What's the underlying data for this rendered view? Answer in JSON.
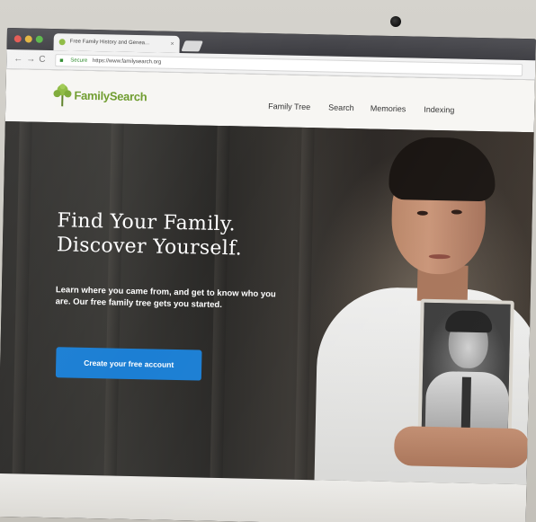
{
  "browser": {
    "tab_title": "Free Family History and Genea...",
    "tab_close": "×",
    "nav_back": "←",
    "nav_forward": "→",
    "nav_reload": "C",
    "secure_label": "Secure",
    "url": "https://www.familysearch.org"
  },
  "site": {
    "logo_text": "FamilySearch",
    "nav": [
      "Family Tree",
      "Search",
      "Memories",
      "Indexing"
    ]
  },
  "hero": {
    "title_line1": "Find Your Family.",
    "title_line2": "Discover Yourself.",
    "subtitle": "Learn where you came from, and get to know who you are. Our free family tree gets you started.",
    "cta_label": "Create your free account"
  },
  "colors": {
    "brand_green": "#6c9a2a",
    "cta_blue": "#1c7fd4"
  },
  "icons": {
    "logo": "tree-icon",
    "lock": "lock-icon"
  }
}
